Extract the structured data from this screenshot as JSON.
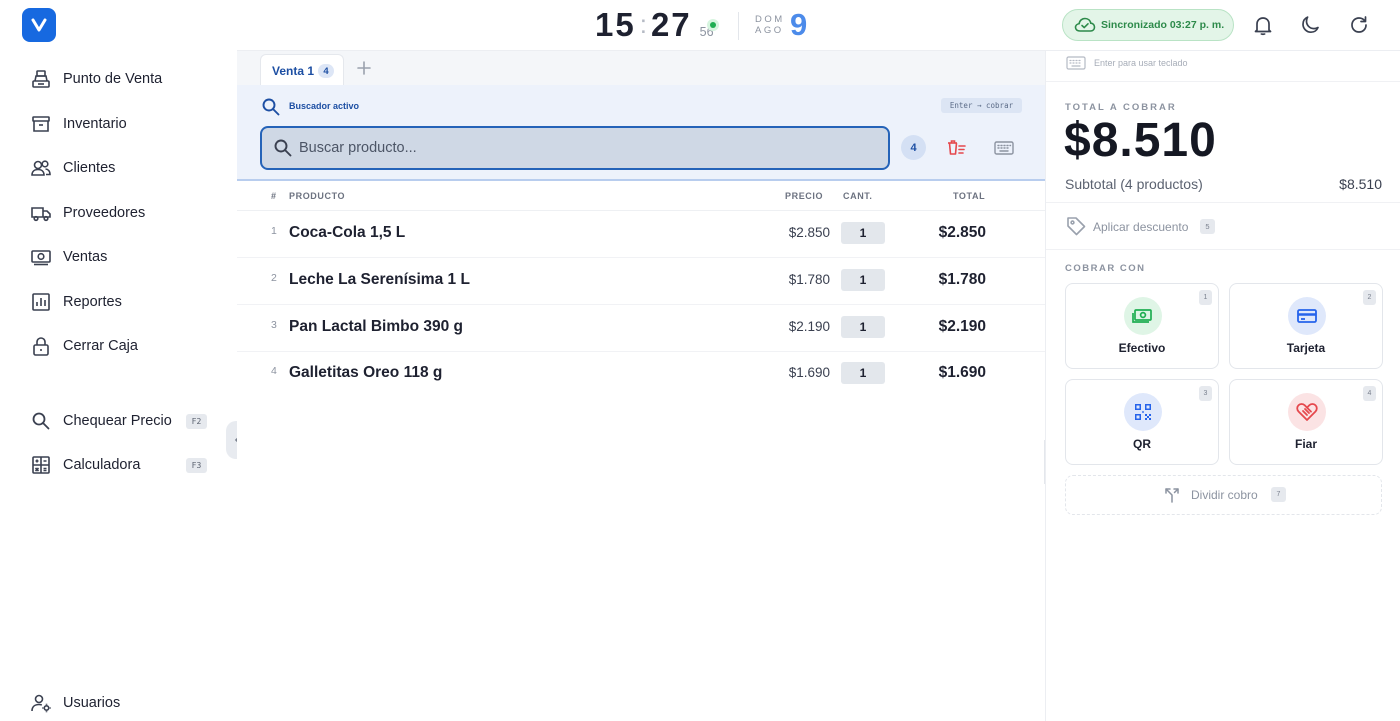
{
  "colors": {
    "brand": "#1769e0",
    "accent": "#2563b8",
    "success": "#1fae52",
    "danger": "#e5484d"
  },
  "sidebar": {
    "items": [
      {
        "label": "Punto de Venta",
        "icon": "cash-register-icon"
      },
      {
        "label": "Inventario",
        "icon": "archive-box-icon"
      },
      {
        "label": "Clientes",
        "icon": "users-icon"
      },
      {
        "label": "Proveedores",
        "icon": "truck-icon"
      },
      {
        "label": "Ventas",
        "icon": "banknote-icon"
      },
      {
        "label": "Reportes",
        "icon": "bar-chart-icon"
      },
      {
        "label": "Cerrar Caja",
        "icon": "lock-icon"
      }
    ],
    "tools": [
      {
        "label": "Chequear Precio",
        "shortcut": "F2",
        "icon": "search-icon"
      },
      {
        "label": "Calculadora",
        "shortcut": "F3",
        "icon": "calculator-icon"
      }
    ],
    "bottom": {
      "label": "Usuarios",
      "icon": "user-settings-icon"
    }
  },
  "topbar": {
    "clock": {
      "hours": "15",
      "separator": ":",
      "minutes": "27",
      "seconds": "56"
    },
    "date": {
      "weekday": "DOM",
      "month": "AGO",
      "day": "9"
    },
    "sync_status": "Sincronizado 03:27 p. m."
  },
  "sale": {
    "tab_label": "Venta 1",
    "tab_count": "4",
    "search_status": "Buscador activo",
    "enter_hint": "Enter → cobrar",
    "search_placeholder": "Buscar producto...",
    "item_count": "4",
    "columns": {
      "index": "#",
      "product": "PRODUCTO",
      "price": "PRECIO",
      "qty": "CANT.",
      "total": "TOTAL"
    },
    "items": [
      {
        "index": "1",
        "name": "Coca-Cola 1,5 L",
        "price": "$2.850",
        "qty": "1",
        "total": "$2.850"
      },
      {
        "index": "2",
        "name": "Leche La Serenísima 1 L",
        "price": "$1.780",
        "qty": "1",
        "total": "$1.780"
      },
      {
        "index": "3",
        "name": "Pan Lactal Bimbo 390 g",
        "price": "$2.190",
        "qty": "1",
        "total": "$2.190"
      },
      {
        "index": "4",
        "name": "Galletitas Oreo 118 g",
        "price": "$1.690",
        "qty": "1",
        "total": "$1.690"
      }
    ]
  },
  "checkout": {
    "keyboard_hint": "Enter para usar teclado",
    "total_label": "TOTAL A COBRAR",
    "total_value": "$8.510",
    "subtotal_label": "Subtotal (4 productos)",
    "subtotal_value": "$8.510",
    "discount_label": "Aplicar descuento",
    "discount_shortcut": "5",
    "pay_with_label": "COBRAR CON",
    "methods": [
      {
        "label": "Efectivo",
        "shortcut": "1",
        "icon": "cash-icon",
        "color": "#1fae52",
        "bg": "#dff5e6"
      },
      {
        "label": "Tarjeta",
        "shortcut": "2",
        "icon": "credit-card-icon",
        "color": "#2563eb",
        "bg": "#dfe8fb"
      },
      {
        "label": "QR",
        "shortcut": "3",
        "icon": "qr-code-icon",
        "color": "#2563eb",
        "bg": "#dfe8fb"
      },
      {
        "label": "Fiar",
        "shortcut": "4",
        "icon": "handshake-icon",
        "color": "#e5484d",
        "bg": "#fbe3e4"
      }
    ],
    "split_label": "Dividir cobro",
    "split_shortcut": "7"
  }
}
